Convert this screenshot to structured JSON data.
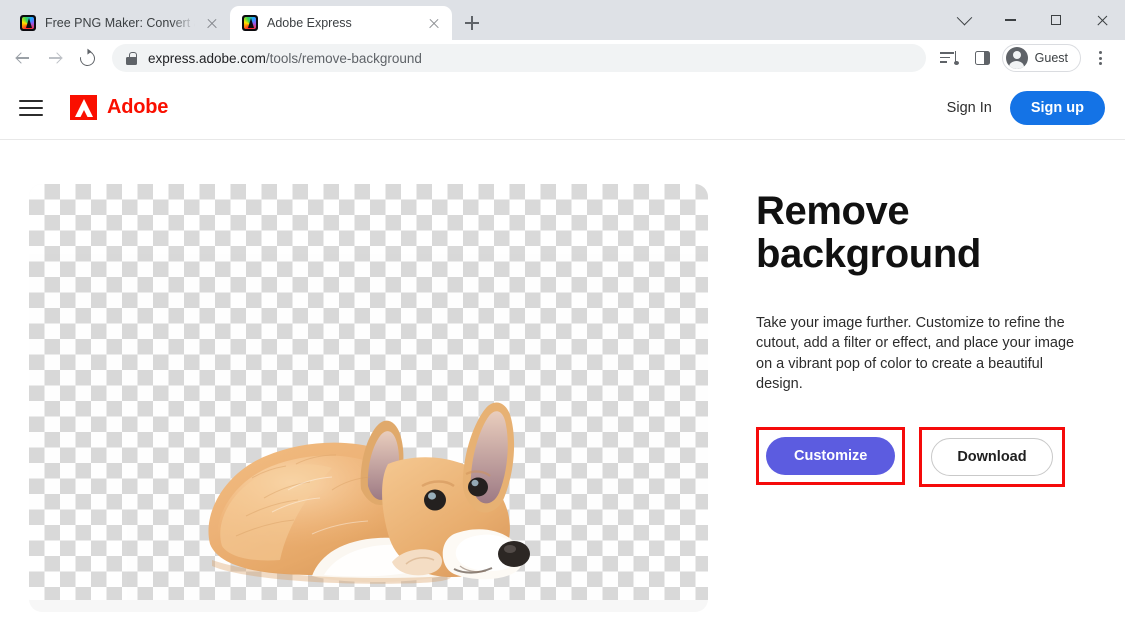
{
  "browser": {
    "tabs": [
      {
        "title": "Free PNG Maker: Convert a JPG",
        "active": false
      },
      {
        "title": "Adobe Express",
        "active": true
      }
    ],
    "new_tab_label": "+",
    "window_controls": [
      "tab-search",
      "minimize",
      "maximize",
      "close"
    ],
    "address_bar": {
      "domain": "express.adobe.com",
      "path": "/tools/remove-background",
      "full_url": "express.adobe.com/tools/remove-background",
      "lock": "secure-lock-icon"
    },
    "toolbar_right": {
      "media_icon": "media-control-icon",
      "panel_icon": "side-panel-icon",
      "profile_label": "Guest",
      "menu_icon": "three-dot-menu-icon"
    }
  },
  "site_header": {
    "menu_icon": "hamburger-menu-icon",
    "brand_name": "Adobe",
    "brand_color": "#fa0f00",
    "sign_in_label": "Sign In",
    "sign_up_label": "Sign up",
    "sign_up_color": "#1473e6"
  },
  "main": {
    "headline": "Remove background",
    "description": "Take your image further. Customize to refine the cutout, add a filter or effect, and place your image on a vibrant pop of color to create a beautiful design.",
    "buttons": {
      "customize_label": "Customize",
      "customize_color": "#5c5ce0",
      "download_label": "Download",
      "download_color": "#ffffff"
    },
    "preview": {
      "alt": "corgi dog with transparent background",
      "background": "transparency-checkerboard"
    },
    "annotation_color": "#f50a0a"
  }
}
